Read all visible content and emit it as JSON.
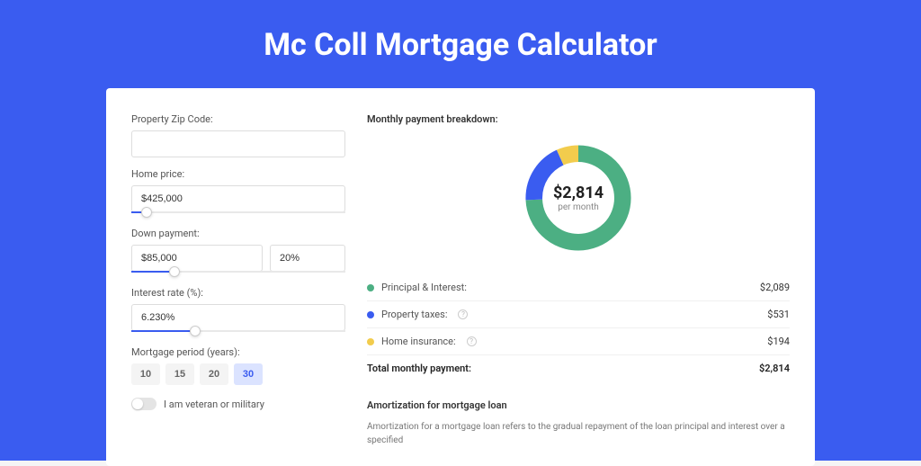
{
  "title": "Mc Coll Mortgage Calculator",
  "form": {
    "zip": {
      "label": "Property Zip Code:",
      "value": ""
    },
    "home_price": {
      "label": "Home price:",
      "value": "$425,000",
      "slider_pct": 7
    },
    "down_payment": {
      "label": "Down payment:",
      "value": "$85,000",
      "pct": "20%",
      "slider_pct": 20
    },
    "interest_rate": {
      "label": "Interest rate (%):",
      "value": "6.230%",
      "slider_pct": 30
    },
    "period": {
      "label": "Mortgage period (years):",
      "options": [
        "10",
        "15",
        "20",
        "30"
      ],
      "selected": "30"
    },
    "veteran": {
      "label": "I am veteran or military"
    }
  },
  "breakdown": {
    "title": "Monthly payment breakdown:",
    "center_amount": "$2,814",
    "center_sub": "per month",
    "items": [
      {
        "label": "Principal & Interest:",
        "value": "$2,089",
        "color": "#4caf83",
        "pct": 0.742,
        "info": false
      },
      {
        "label": "Property taxes:",
        "value": "$531",
        "color": "#3a5cf0",
        "pct": 0.189,
        "info": true
      },
      {
        "label": "Home insurance:",
        "value": "$194",
        "color": "#f2cc4d",
        "pct": 0.069,
        "info": true
      }
    ],
    "total_label": "Total monthly payment:",
    "total_value": "$2,814"
  },
  "amortization": {
    "title": "Amortization for mortgage loan",
    "text": "Amortization for a mortgage loan refers to the gradual repayment of the loan principal and interest over a specified"
  },
  "chart_data": {
    "type": "pie",
    "title": "Monthly payment breakdown",
    "series": [
      {
        "name": "Principal & Interest",
        "value": 2089,
        "color": "#4caf83"
      },
      {
        "name": "Property taxes",
        "value": 531,
        "color": "#3a5cf0"
      },
      {
        "name": "Home insurance",
        "value": 194,
        "color": "#f2cc4d"
      }
    ],
    "total": 2814,
    "unit": "USD per month"
  }
}
